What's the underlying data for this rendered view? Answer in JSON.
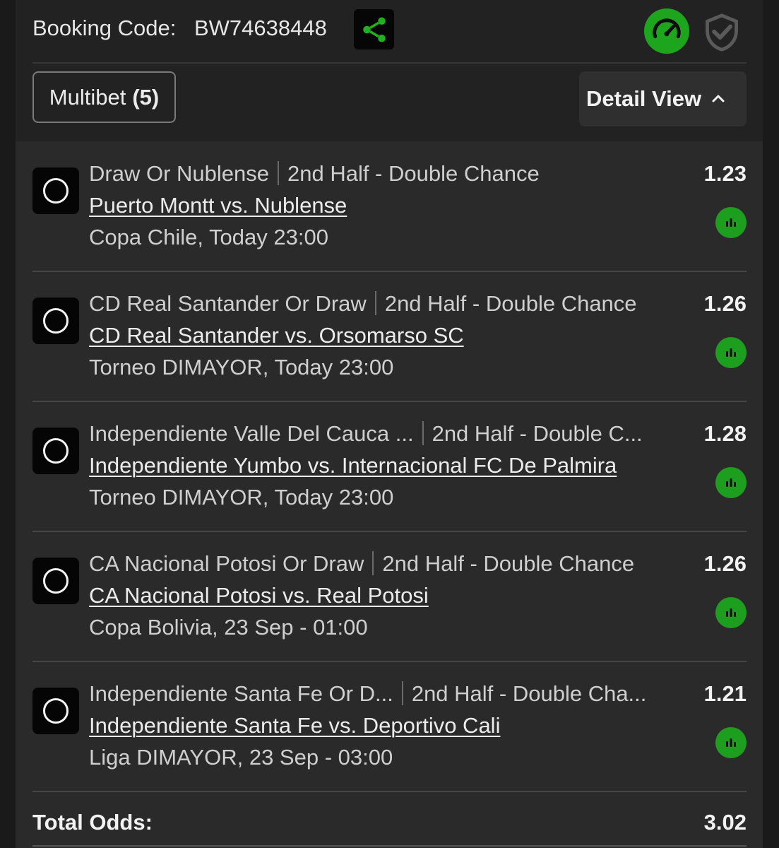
{
  "header": {
    "booking_label": "Booking Code:",
    "booking_code": "BW74638448",
    "share_icon": "share-icon",
    "speed_icon": "speedometer-icon",
    "shield_icon": "shield-check-icon"
  },
  "toolbar": {
    "multibet_label": "Multibet",
    "multibet_count": "(5)",
    "detail_view_label": "Detail View",
    "detail_view_icon": "chevron-up-icon"
  },
  "bets": [
    {
      "selection": "Draw Or Nublense",
      "market": "2nd Half - Double Chance",
      "match": "Puerto Montt vs. Nublense",
      "league_time": "Copa Chile, Today 23:00",
      "odds": "1.23"
    },
    {
      "selection": "CD Real Santander Or Draw",
      "market": "2nd Half - Double Chance",
      "match": "CD Real Santander vs. Orsomarso SC",
      "league_time": "Torneo DIMAYOR, Today 23:00",
      "odds": "1.26"
    },
    {
      "selection": "Independiente Valle Del Cauca ...",
      "market": "2nd Half - Double C...",
      "match": "Independiente Yumbo vs. Internacional FC De Palmira",
      "league_time": "Torneo DIMAYOR, Today 23:00",
      "odds": "1.28"
    },
    {
      "selection": "CA Nacional Potosi Or Draw",
      "market": "2nd Half - Double Chance",
      "match": "CA Nacional Potosi vs. Real Potosi",
      "league_time": "Copa Bolivia, 23 Sep - 01:00",
      "odds": "1.26"
    },
    {
      "selection": "Independiente Santa Fe Or D...",
      "market": "2nd Half - Double Cha...",
      "match": "Independiente Santa Fe vs. Deportivo Cali",
      "league_time": "Liga DIMAYOR, 23 Sep - 03:00",
      "odds": "1.21"
    }
  ],
  "total": {
    "label": "Total Odds:",
    "value": "3.02"
  },
  "colors": {
    "accent_green": "#1ea51e",
    "background": "#222222",
    "list_background": "#2a2a2a"
  }
}
